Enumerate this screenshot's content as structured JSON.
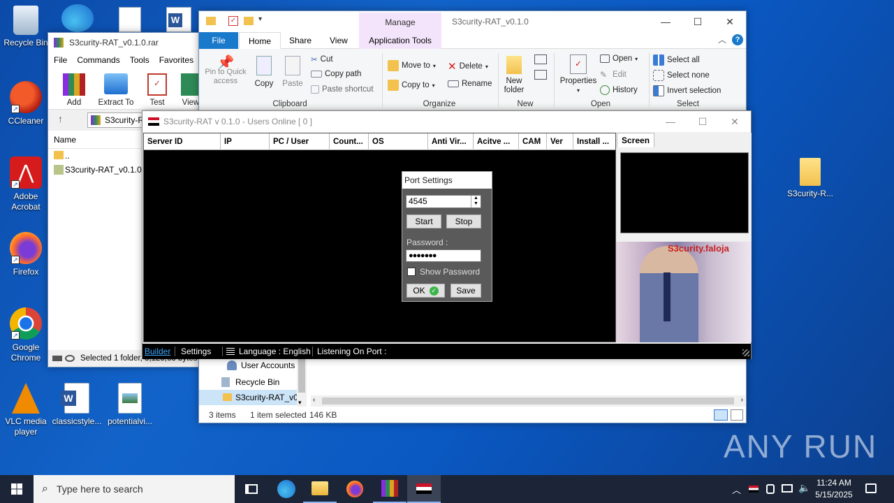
{
  "desktop": {
    "icons_left": [
      {
        "label": "Recycle Bin",
        "icon": "recycle-bin-icon"
      },
      {
        "label": "CCleaner",
        "icon": "ccleaner-icon"
      },
      {
        "label": "Adobe Acrobat",
        "icon": "adobe-acrobat-icon"
      },
      {
        "label": "Firefox",
        "icon": "firefox-icon"
      },
      {
        "label": "Google Chrome",
        "icon": "chrome-icon"
      },
      {
        "label": "VLC media player",
        "icon": "vlc-icon"
      }
    ],
    "icons_bottom": [
      {
        "label": "classicstyle...",
        "icon": "word-document-icon"
      },
      {
        "label": "potentialvi...",
        "icon": "image-file-icon"
      }
    ],
    "folder_right": {
      "label": "S3curity-R...",
      "icon": "folder-icon"
    },
    "watermark": "ANY RUN"
  },
  "winrar": {
    "title": "S3curity-RAT_v0.1.0.rar",
    "menu": [
      "File",
      "Commands",
      "Tools",
      "Favorites"
    ],
    "toolbar": [
      "Add",
      "Extract To",
      "Test",
      "View"
    ],
    "path": "S3curity-RA",
    "column_name": "Name",
    "rows": [
      "..",
      "S3curity-RAT_v0.1.0"
    ],
    "status": "Selected 1 folder, 3,125,63 bytes"
  },
  "explorer": {
    "title": "S3curity-RAT_v0.1.0",
    "manage_label": "Manage",
    "tabs": [
      "File",
      "Home",
      "Share",
      "View",
      "Application Tools"
    ],
    "clipboard": {
      "pin": "Pin to Quick access",
      "copy": "Copy",
      "paste": "Paste",
      "cut": "Cut",
      "copy_path": "Copy path",
      "paste_shortcut": "Paste shortcut",
      "group": "Clipboard"
    },
    "organize": {
      "move_to": "Move to",
      "copy_to": "Copy to",
      "delete": "Delete",
      "rename": "Rename",
      "group": "Organize"
    },
    "new": {
      "new_folder": "New folder",
      "group": "New"
    },
    "open": {
      "properties": "Properties",
      "open": "Open",
      "edit": "Edit",
      "history": "History",
      "group": "Open"
    },
    "select": {
      "select_all": "Select all",
      "select_none": "Select none",
      "invert": "Invert selection",
      "group": "Select"
    },
    "nav": [
      "User Accounts",
      "Recycle Bin",
      "S3curity-RAT_v0."
    ],
    "status_items": "3 items",
    "status_selected": "1 item selected",
    "status_size": "146 KB"
  },
  "rat": {
    "title": "S3curity-RAT v 0.1.0 - Users Online [ 0 ]",
    "columns": [
      "Server ID",
      "IP",
      "PC / User",
      "Count...",
      "OS",
      "Anti Vir...",
      "Acitve ...",
      "CAM",
      "Ver",
      "Install ..."
    ],
    "screen_tab": "Screen",
    "banner_text": "S3curity.faloja",
    "status": {
      "builder": "Builder",
      "settings": "Settings",
      "language": "Language : English",
      "listening": "Listening On Port :"
    },
    "port_dialog": {
      "title": "Port Settings",
      "port": "4545",
      "start": "Start",
      "stop": "Stop",
      "password_label": "Password :",
      "password": "●●●●●●●",
      "show_password": "Show Password",
      "ok": "OK",
      "save": "Save"
    }
  },
  "taskbar": {
    "search_placeholder": "Type here to search",
    "time": "11:24 AM",
    "date": "5/15/2025"
  }
}
